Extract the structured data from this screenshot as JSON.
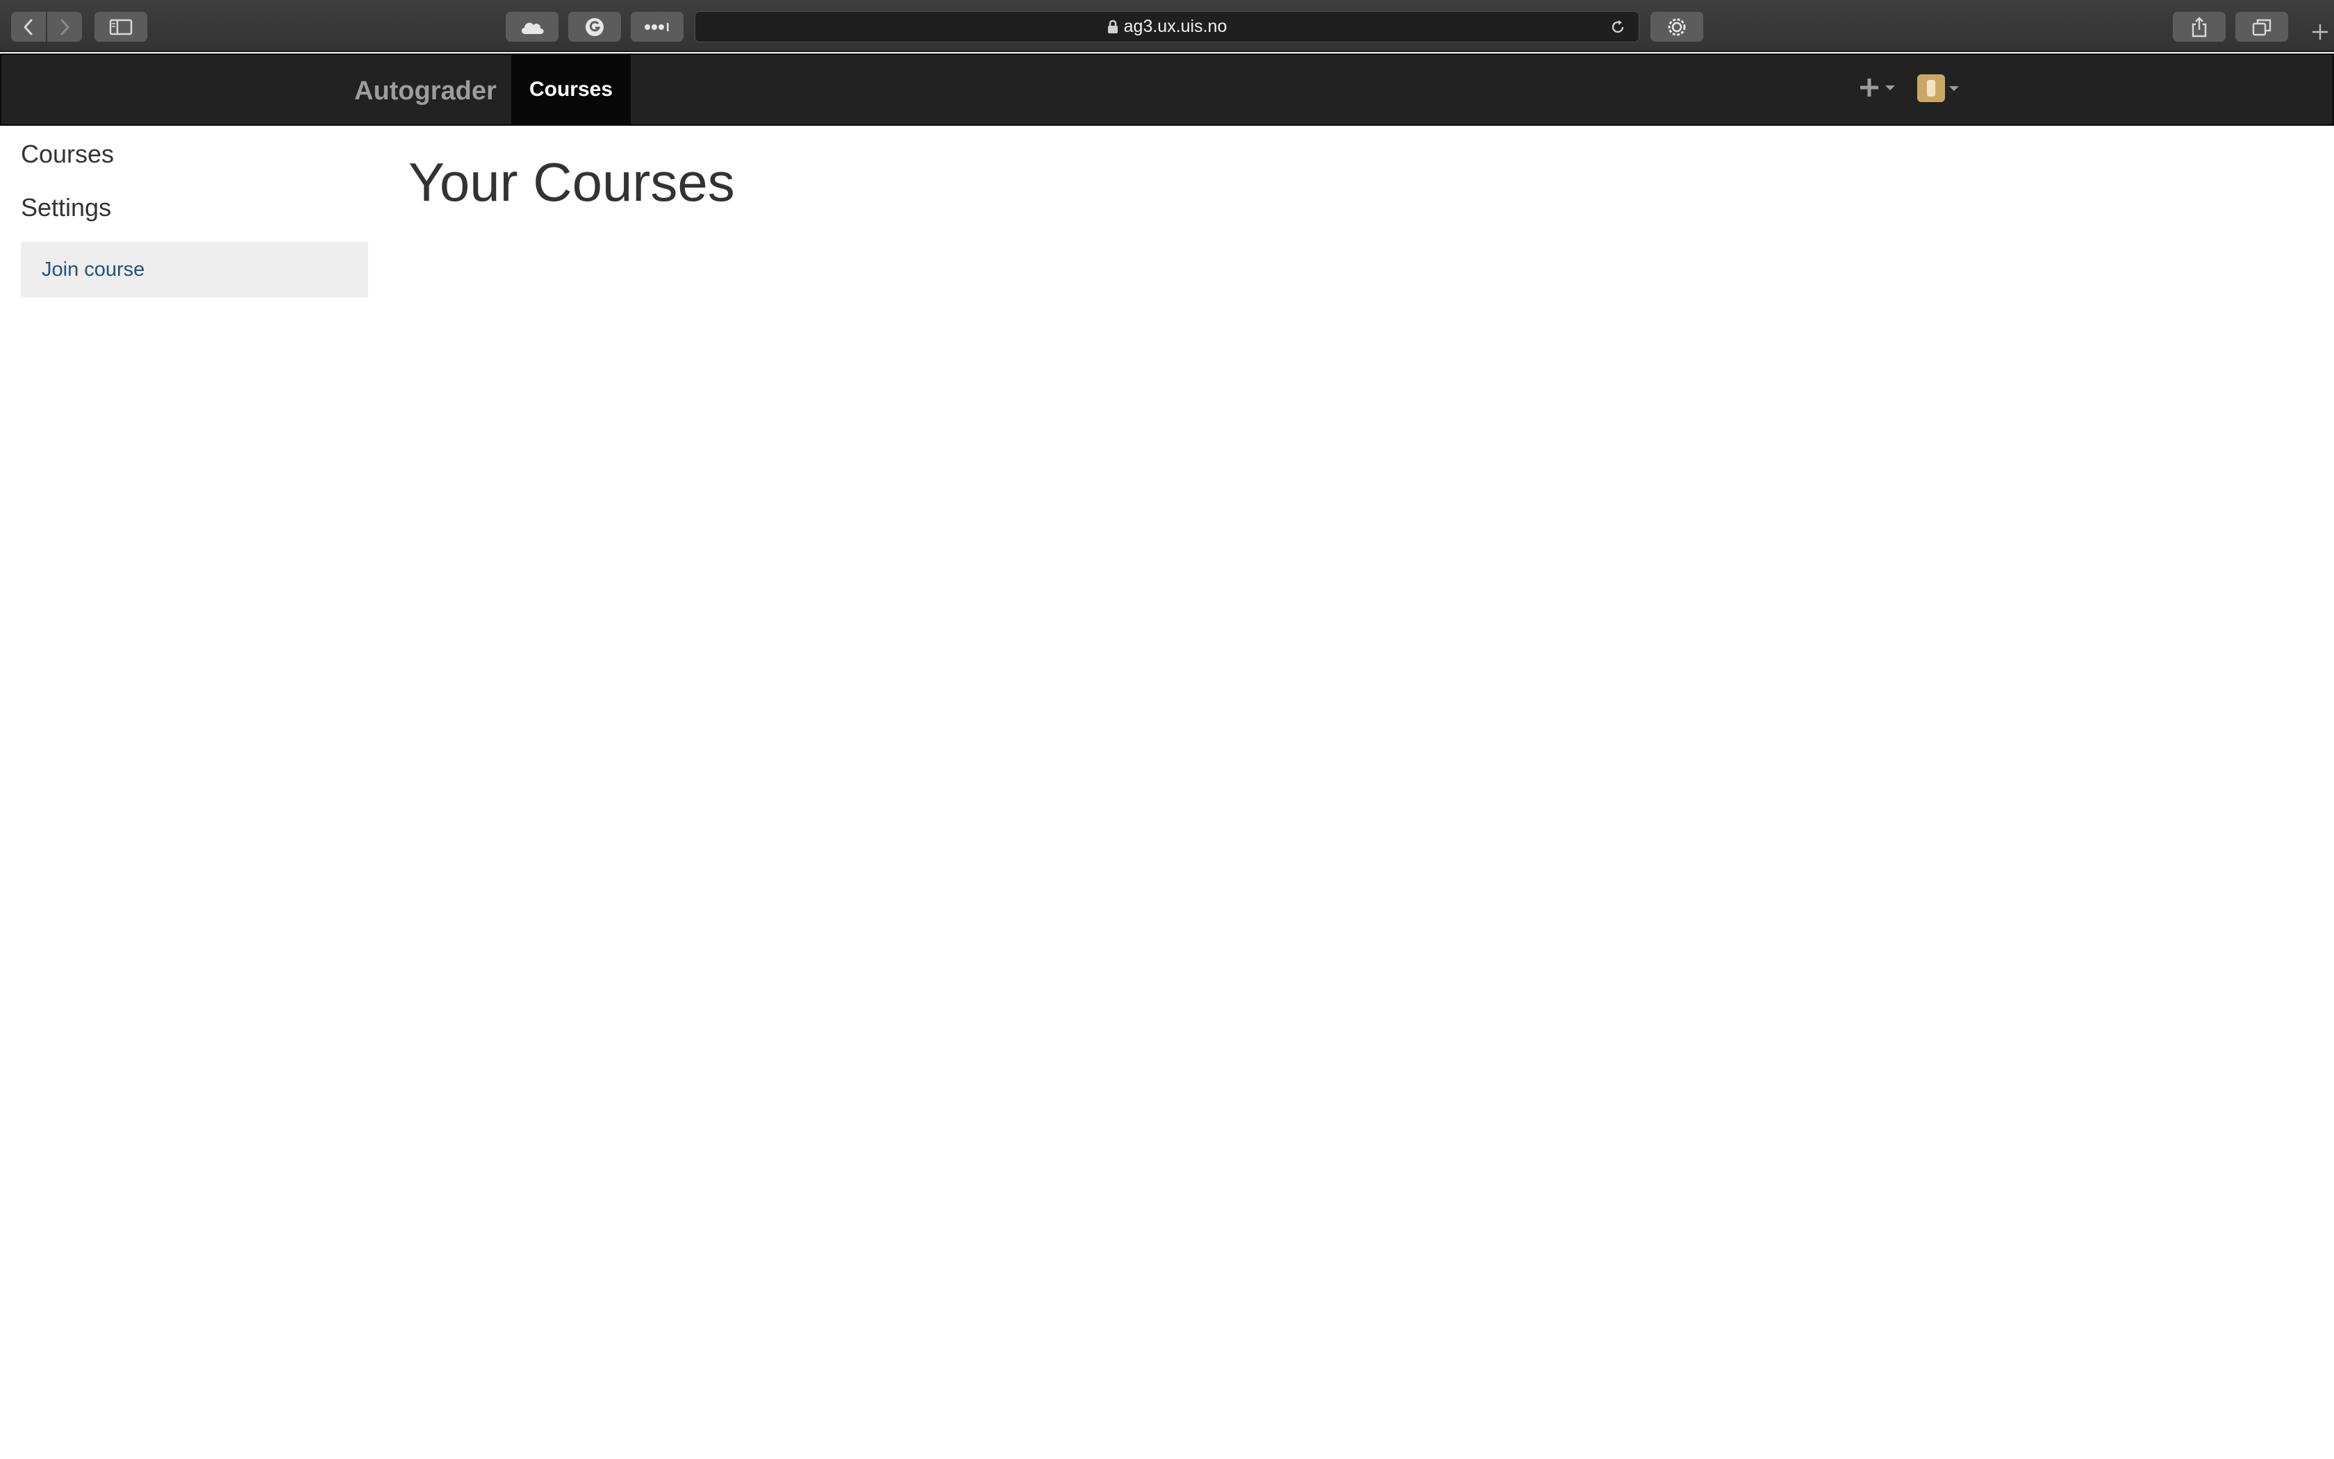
{
  "browser": {
    "url": "ag3.ux.uis.no"
  },
  "navbar": {
    "brand": "Autograder",
    "active_item": "Courses"
  },
  "sidebar": {
    "headings": [
      "Courses",
      "Settings"
    ],
    "links": [
      {
        "label": "Join course"
      }
    ]
  },
  "main": {
    "title": "Your Courses"
  },
  "colors": {
    "navbar_bg": "#222222",
    "navbar_active_bg": "#080808",
    "link": "#23527c",
    "sidebar_link_bg": "#eeeeee",
    "text": "#333333"
  }
}
